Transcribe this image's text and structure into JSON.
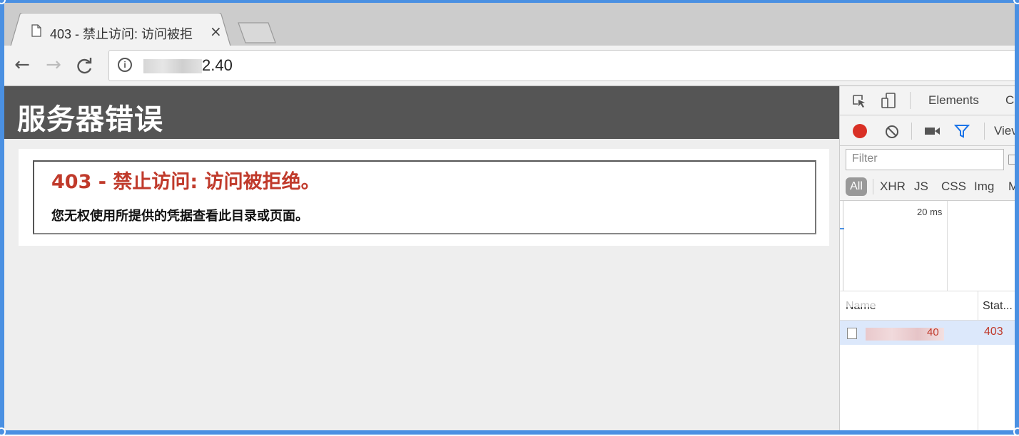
{
  "browser": {
    "tab_title": "403 - 禁止访问: 访问被拒",
    "tab_close": "×",
    "url_suffix": "2.40",
    "nav_back": "←",
    "nav_forward": "→",
    "nav_reload": "C",
    "info_glyph": "i"
  },
  "page": {
    "header_title": "服务器错误",
    "error_heading": "403 - 禁止访问: 访问被拒绝。",
    "error_message": "您无权使用所提供的凭据查看此目录或页面。"
  },
  "devtools": {
    "tabs": [
      "Elements",
      "C"
    ],
    "view_label": "Viev",
    "filter_placeholder": "Filter",
    "types": [
      "All",
      "XHR",
      "JS",
      "CSS",
      "Img",
      "M"
    ],
    "timeline_label": "20 ms",
    "columns": {
      "name": "Name",
      "status": "Stat..."
    },
    "rows": [
      {
        "name": "40",
        "status": "403"
      }
    ],
    "colors": {
      "recording": "#d93025",
      "error_text": "#c0392b"
    }
  }
}
